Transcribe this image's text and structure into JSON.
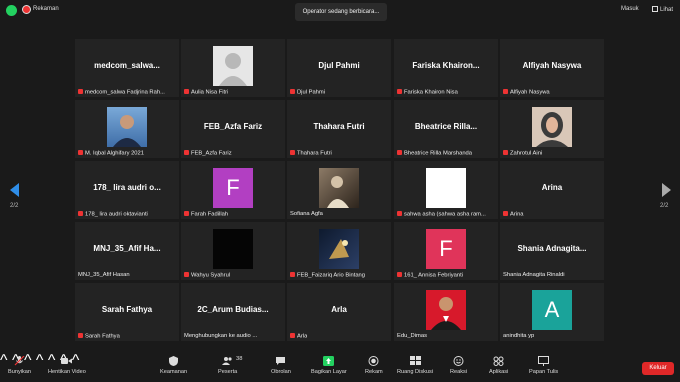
{
  "topbar": {
    "recording_label": "Rekaman",
    "speaker_banner": "Operator sedang berbicara...",
    "exit_full_label": "Masuk",
    "view_label": "Lihat"
  },
  "pagination": {
    "left": "2/2",
    "right": "2/2"
  },
  "tiles": [
    {
      "big": "medcom_salwa...",
      "label": "medcom_salwa Fadjrina Rah...",
      "muted": true
    },
    {
      "big": "",
      "label": "Aulia Nisa Fitri",
      "muted": true,
      "pic": "default-avatar"
    },
    {
      "big": "Djul Pahmi",
      "label": "Djul Pahmi",
      "muted": true
    },
    {
      "big": "Fariska  Khairon...",
      "label": "Fariska Khairon Nisa",
      "muted": true
    },
    {
      "big": "Alfiyah Nasywa",
      "label": "Alfiyah Nasywa",
      "muted": true
    },
    {
      "big": "",
      "label": "M. Iqbal Alghifary 2021",
      "muted": true,
      "pic": "photo-man-blue"
    },
    {
      "big": "FEB_Azfa Fariz",
      "label": "FEB_Azfa Fariz",
      "muted": true
    },
    {
      "big": "Thahara Futri",
      "label": "Thahara Futri",
      "muted": true
    },
    {
      "big": "Bheatrice  Rilla...",
      "label": "Bheatrice Rilla Marshanda",
      "muted": true
    },
    {
      "big": "",
      "label": "Zahrotul Aini",
      "muted": true,
      "pic": "photo-woman-hijab"
    },
    {
      "big": "178_ lira audri o...",
      "label": "178_ lira audri oktavianti",
      "muted": true
    },
    {
      "big": "",
      "label": "Farah Fadillah",
      "muted": true,
      "pic": "letter",
      "letter": "F",
      "color": "#b23fc2"
    },
    {
      "big": "",
      "label": "Sofiana Agfa",
      "muted": false,
      "pic": "photo-sepia"
    },
    {
      "big": "",
      "label": "sahwa asha (sahwa asha ram...",
      "muted": true,
      "pic": "white-square"
    },
    {
      "big": "Arina",
      "label": "Arina",
      "muted": true
    },
    {
      "big": "MNJ_35_Afif  Ha...",
      "label": "MNJ_35_Afif Hasan",
      "muted": false
    },
    {
      "big": "",
      "label": "Wahyu Syahrul",
      "muted": true,
      "pic": "black-square"
    },
    {
      "big": "",
      "label": "FEB_Faizariq Ario Bintang",
      "muted": true,
      "pic": "photo-dark-art"
    },
    {
      "big": "",
      "label": "161_ Annisa Febriyanti",
      "muted": true,
      "pic": "letter",
      "letter": "F",
      "color": "#e0345a"
    },
    {
      "big": "Shania  Adnagita...",
      "label": "Shania Adnagita Rinaldi",
      "muted": false
    },
    {
      "big": "Sarah Fathya",
      "label": "Sarah Fathya",
      "muted": true
    },
    {
      "big": "2C_Arum  Budias...",
      "label": "Menghubungkan ke audio ...",
      "muted": false
    },
    {
      "big": "Arla",
      "label": "Arla",
      "muted": true
    },
    {
      "big": "",
      "label": "Edu_Dimas",
      "muted": false,
      "pic": "photo-man-red"
    },
    {
      "big": "",
      "label": "anindhita yp",
      "muted": false,
      "pic": "letter",
      "letter": "A",
      "color": "#1aa39a"
    }
  ],
  "toolbar": {
    "mute": "Bunyikan",
    "video": "Hentikan Video",
    "security": "Keamanan",
    "participants": "Peserta",
    "participant_count": "38",
    "chat": "Obrolan",
    "share": "Bagikan Layar",
    "record": "Rekam",
    "breakout": "Ruang Diskusi",
    "reactions": "Reaksi",
    "apps": "Aplikasi",
    "whiteboard": "Papan Tulis",
    "leave": "Keluar"
  },
  "colors": {
    "share_accent": "#23d160",
    "leave_red": "#e02828",
    "nav_blue": "#2f8ee8"
  }
}
